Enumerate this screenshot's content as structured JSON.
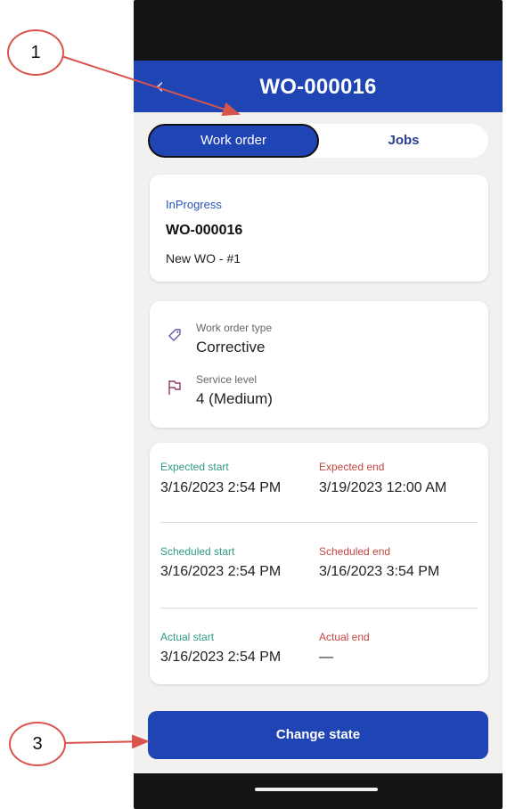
{
  "header": {
    "title": "WO-000016",
    "back_glyph": "‹"
  },
  "tabs": [
    {
      "label": "Work order",
      "active": true
    },
    {
      "label": "Jobs",
      "active": false
    }
  ],
  "summary": {
    "status": "InProgress",
    "number": "WO-000016",
    "name": "New WO - #1"
  },
  "details": {
    "type_label": "Work order type",
    "type_value": "Corrective",
    "service_label": "Service level",
    "service_value": "4 (Medium)",
    "icons": [
      "tag-icon",
      "flag-icon"
    ]
  },
  "schedule": {
    "expected_start_label": "Expected start",
    "expected_start": "3/16/2023 2:54 PM",
    "expected_end_label": "Expected end",
    "expected_end": "3/19/2023 12:00 AM",
    "scheduled_start_label": "Scheduled start",
    "scheduled_start": "3/16/2023 2:54 PM",
    "scheduled_end_label": "Scheduled end",
    "scheduled_end": "3/16/2023 3:54 PM",
    "actual_start_label": "Actual start",
    "actual_start": "3/16/2023 2:54 PM",
    "actual_end_label": "Actual end",
    "actual_end": "—"
  },
  "actions": {
    "change_state": "Change state"
  },
  "callouts": {
    "one": "1",
    "three": "3"
  },
  "colors": {
    "header": "#1f44b4",
    "callout_border": "#d9544d",
    "start_label": "#2e9b82",
    "end_label": "#c4453f"
  }
}
